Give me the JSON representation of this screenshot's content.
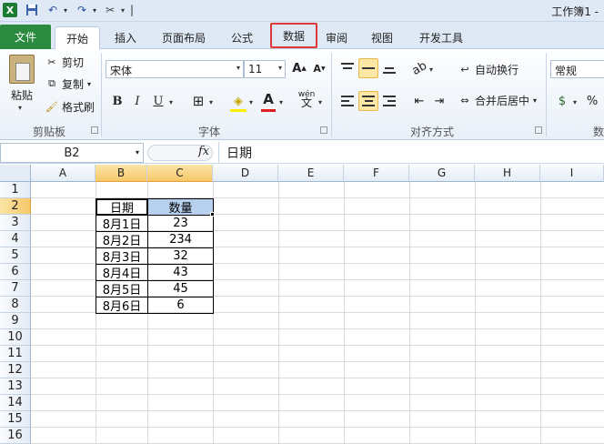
{
  "window": {
    "title": "工作簿1 -"
  },
  "qat": {
    "excel_glyph": "X",
    "separator": "|"
  },
  "tabs": {
    "file": "文件",
    "home": "开始",
    "insert": "插入",
    "layout": "页面布局",
    "formula": "公式",
    "data": "数据",
    "review": "审阅",
    "view": "视图",
    "dev": "开发工具"
  },
  "ribbon": {
    "clipboard": {
      "paste": "粘贴",
      "cut": "剪切",
      "copy": "复制",
      "format_painter": "格式刷",
      "label": "剪贴板"
    },
    "font": {
      "name": "宋体",
      "size": "11",
      "bold": "B",
      "italic": "I",
      "underline": "U",
      "phonetic": "wén",
      "label": "字体"
    },
    "alignment": {
      "wrap": "自动换行",
      "merge": "合并后居中",
      "label": "对齐方式"
    },
    "number": {
      "format": "常规",
      "percent": "%",
      "label": "数"
    }
  },
  "formula_bar": {
    "name_box": "B2",
    "fx": "fx",
    "content": "日期"
  },
  "grid": {
    "columns": [
      "A",
      "B",
      "C",
      "D",
      "E",
      "F",
      "G",
      "H",
      "I"
    ],
    "rows": [
      "1",
      "2",
      "3",
      "4",
      "5",
      "6",
      "7",
      "8",
      "9",
      "10",
      "11",
      "12",
      "13",
      "14",
      "15",
      "16"
    ],
    "table": {
      "headers": [
        "日期",
        "数量"
      ],
      "rows": [
        [
          "8月1日",
          "23"
        ],
        [
          "8月2日",
          "234"
        ],
        [
          "8月3日",
          "32"
        ],
        [
          "8月4日",
          "43"
        ],
        [
          "8月5日",
          "45"
        ],
        [
          "8月6日",
          "6"
        ]
      ]
    }
  },
  "colors": {
    "file_tab": "#2a8a3e",
    "highlight_box": "#e0393c",
    "selected_header": "#f6c86a",
    "selected_cell": "#b7d0ee"
  }
}
